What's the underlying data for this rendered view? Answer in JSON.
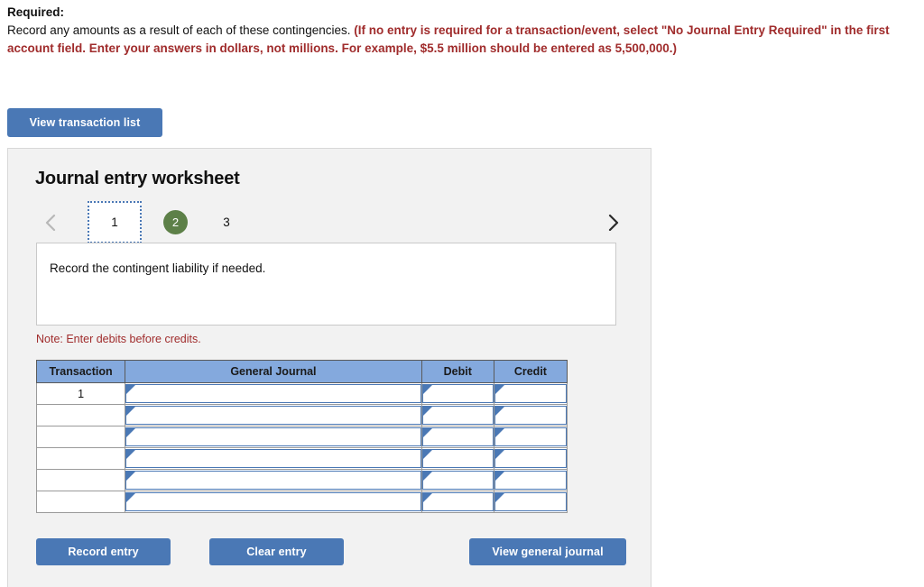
{
  "instructions": {
    "label": "Required:",
    "body_plain": "Record any amounts as a result of each of these contingencies.",
    "body_emphasis": "(If no entry is required for a transaction/event, select \"No Journal Entry Required\" in the first account field. Enter your answers in dollars, not millions. For example, $5.5 million should be entered as 5,500,000.)"
  },
  "toolbar": {
    "view_transaction_list_label": "View transaction list"
  },
  "worksheet": {
    "title": "Journal entry worksheet",
    "pager": {
      "prev_icon": "chevron-left-icon",
      "next_icon": "chevron-right-icon",
      "tabs": [
        {
          "label": "1",
          "state": "current"
        },
        {
          "label": "2",
          "state": "completed"
        },
        {
          "label": "3",
          "state": "pending"
        }
      ]
    },
    "prompt": "Record the contingent liability if needed.",
    "note": "Note: Enter debits before credits.",
    "table": {
      "headers": [
        "Transaction",
        "General Journal",
        "Debit",
        "Credit"
      ],
      "rows": [
        {
          "transaction": "1",
          "general_journal": "",
          "debit": "",
          "credit": ""
        },
        {
          "transaction": "",
          "general_journal": "",
          "debit": "",
          "credit": ""
        },
        {
          "transaction": "",
          "general_journal": "",
          "debit": "",
          "credit": ""
        },
        {
          "transaction": "",
          "general_journal": "",
          "debit": "",
          "credit": ""
        },
        {
          "transaction": "",
          "general_journal": "",
          "debit": "",
          "credit": ""
        },
        {
          "transaction": "",
          "general_journal": "",
          "debit": "",
          "credit": ""
        }
      ]
    },
    "actions": {
      "record_entry_label": "Record entry",
      "clear_entry_label": "Clear entry",
      "view_general_journal_label": "View general journal"
    }
  },
  "colors": {
    "button_blue": "#4a78b5",
    "header_blue": "#84a9dd",
    "completed_green": "#5d8048",
    "emphasis_red": "#a02c2c",
    "panel_gray": "#f2f2f2"
  }
}
